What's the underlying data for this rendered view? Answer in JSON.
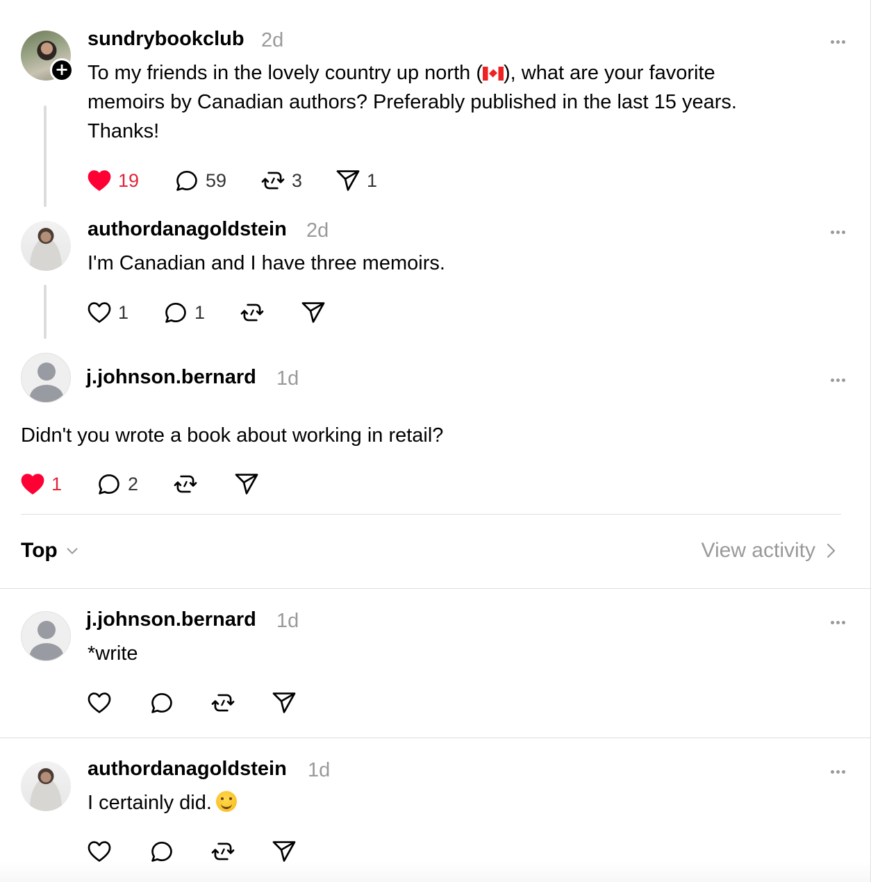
{
  "posts": [
    {
      "username": "sundrybookclub",
      "time": "2d",
      "text_before_flag": "To my friends in the lovely country up north (",
      "text_after_flag": "), what are your favorite memoirs by Canadian authors? Preferably published in the last 15 years. Thanks!",
      "likes": "19",
      "replies": "59",
      "reposts": "3",
      "shares": "1",
      "liked": true
    },
    {
      "username": "authordanagoldstein",
      "time": "2d",
      "text": "I'm Canadian and I have three memoirs.",
      "likes": "1",
      "replies": "1",
      "liked": false
    },
    {
      "username": "j.johnson.bernard",
      "time": "1d",
      "text": "Didn't you wrote a book about working in retail?",
      "likes": "1",
      "replies": "2",
      "liked": true
    }
  ],
  "sort": {
    "label": "Top",
    "view_activity": "View activity"
  },
  "comments": [
    {
      "username": "j.johnson.bernard",
      "time": "1d",
      "text": "*write"
    },
    {
      "username": "authordanagoldstein",
      "time": "1d",
      "text": "I certainly did."
    }
  ],
  "colors": {
    "like_red": "#e0243a",
    "muted": "#999999",
    "divider": "#dedede"
  },
  "icons": [
    "heart-icon",
    "reply-icon",
    "repost-icon",
    "share-icon",
    "more-icon",
    "chevron-down-icon",
    "chevron-right-icon",
    "plus-icon",
    "canada-flag-icon",
    "smile-emoji-icon"
  ]
}
